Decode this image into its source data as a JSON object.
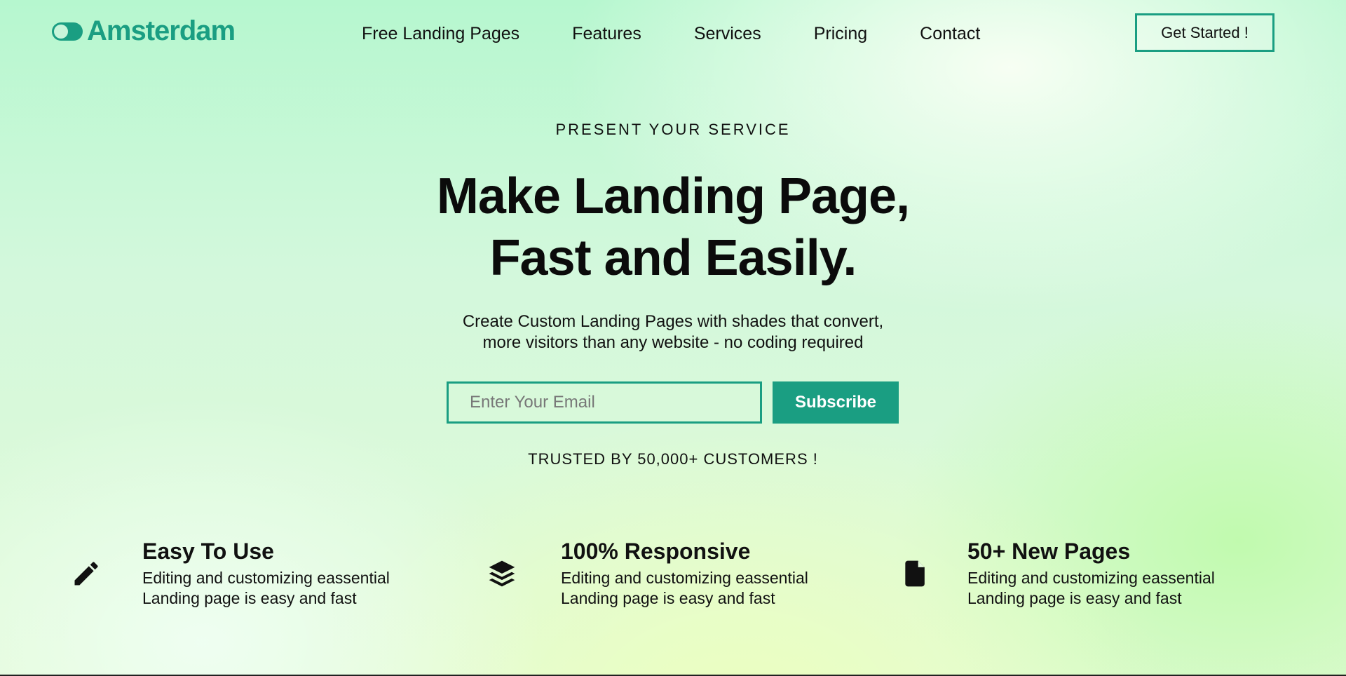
{
  "brand": {
    "name": "Amsterdam",
    "color": "#1a9e82"
  },
  "nav": {
    "links": [
      "Free Landing Pages",
      "Features",
      "Services",
      "Pricing",
      "Contact"
    ],
    "cta": "Get Started !"
  },
  "hero": {
    "eyebrow": "PRESENT YOUR SERVICE",
    "headline_line1": "Make Landing Page,",
    "headline_line2": "Fast and Easily.",
    "subtext_line1": "Create Custom Landing Pages with shades that convert,",
    "subtext_line2": "more visitors than any website - no coding required",
    "email_placeholder": "Enter Your Email",
    "subscribe_label": "Subscribe",
    "trusted": "TRUSTED BY 50,000+ CUSTOMERS !"
  },
  "features": [
    {
      "icon": "pencil-icon",
      "title": "Easy To Use",
      "desc_line1": "Editing and customizing eassential",
      "desc_line2": "Landing page is easy and fast"
    },
    {
      "icon": "layers-icon",
      "title": "100% Responsive",
      "desc_line1": "Editing and customizing eassential",
      "desc_line2": "Landing page is easy and fast"
    },
    {
      "icon": "file-icon",
      "title": "50+ New Pages",
      "desc_line1": "Editing and customizing eassential",
      "desc_line2": "Landing page is easy and fast"
    }
  ]
}
